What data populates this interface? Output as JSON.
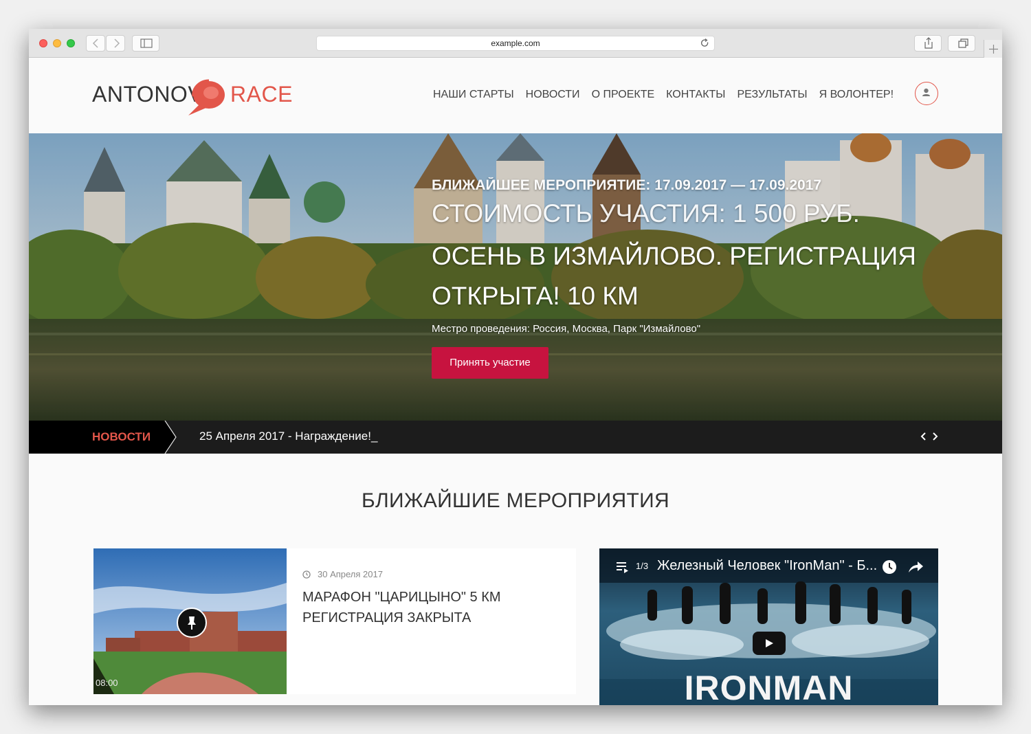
{
  "browser": {
    "url": "example.com"
  },
  "site": {
    "logo_left": "ANTONOV",
    "logo_right": "RACE",
    "nav": [
      "НАШИ СТАРТЫ",
      "НОВОСТИ",
      "О ПРОЕКТЕ",
      "КОНТАКТЫ",
      "РЕЗУЛЬТАТЫ",
      "Я ВОЛОНТЕР!"
    ]
  },
  "hero": {
    "date_line": "БЛИЖАЙШЕЕ МЕРОПРИЯТИЕ: 17.09.2017 — 17.09.2017",
    "price_line": "СТОИМОСТЬ УЧАСТИЯ: 1 500 РУБ.",
    "title": "ОСЕНЬ В ИЗМАЙЛОВО. РЕГИСТРАЦИЯ ОТКРЫТА! 10 КМ",
    "place": "Местро проведения: Россия, Москва, Парк \"Измайлово\"",
    "button": "Принять участие"
  },
  "ticker": {
    "label": "НОВОСТИ",
    "text": "25 Апреля 2017 - Награждение!_"
  },
  "events": {
    "section_title": "БЛИЖАЙШИЕ МЕРОПРИЯТИЯ",
    "card": {
      "date": "30 Апреля 2017",
      "title": "МАРАФОН \"ЦАРИЦЫНО\" 5 КМ РЕГИСТРАЦИЯ ЗАКРЫТА",
      "time": "08:00"
    },
    "video": {
      "count": "1/3",
      "title": "Железный Человек \"IronMan\" - Б...",
      "brand": "IRONMAN"
    }
  },
  "colors": {
    "accent": "#e2564a",
    "button": "#c7133f",
    "ticker_bg": "#1c1c1c"
  }
}
